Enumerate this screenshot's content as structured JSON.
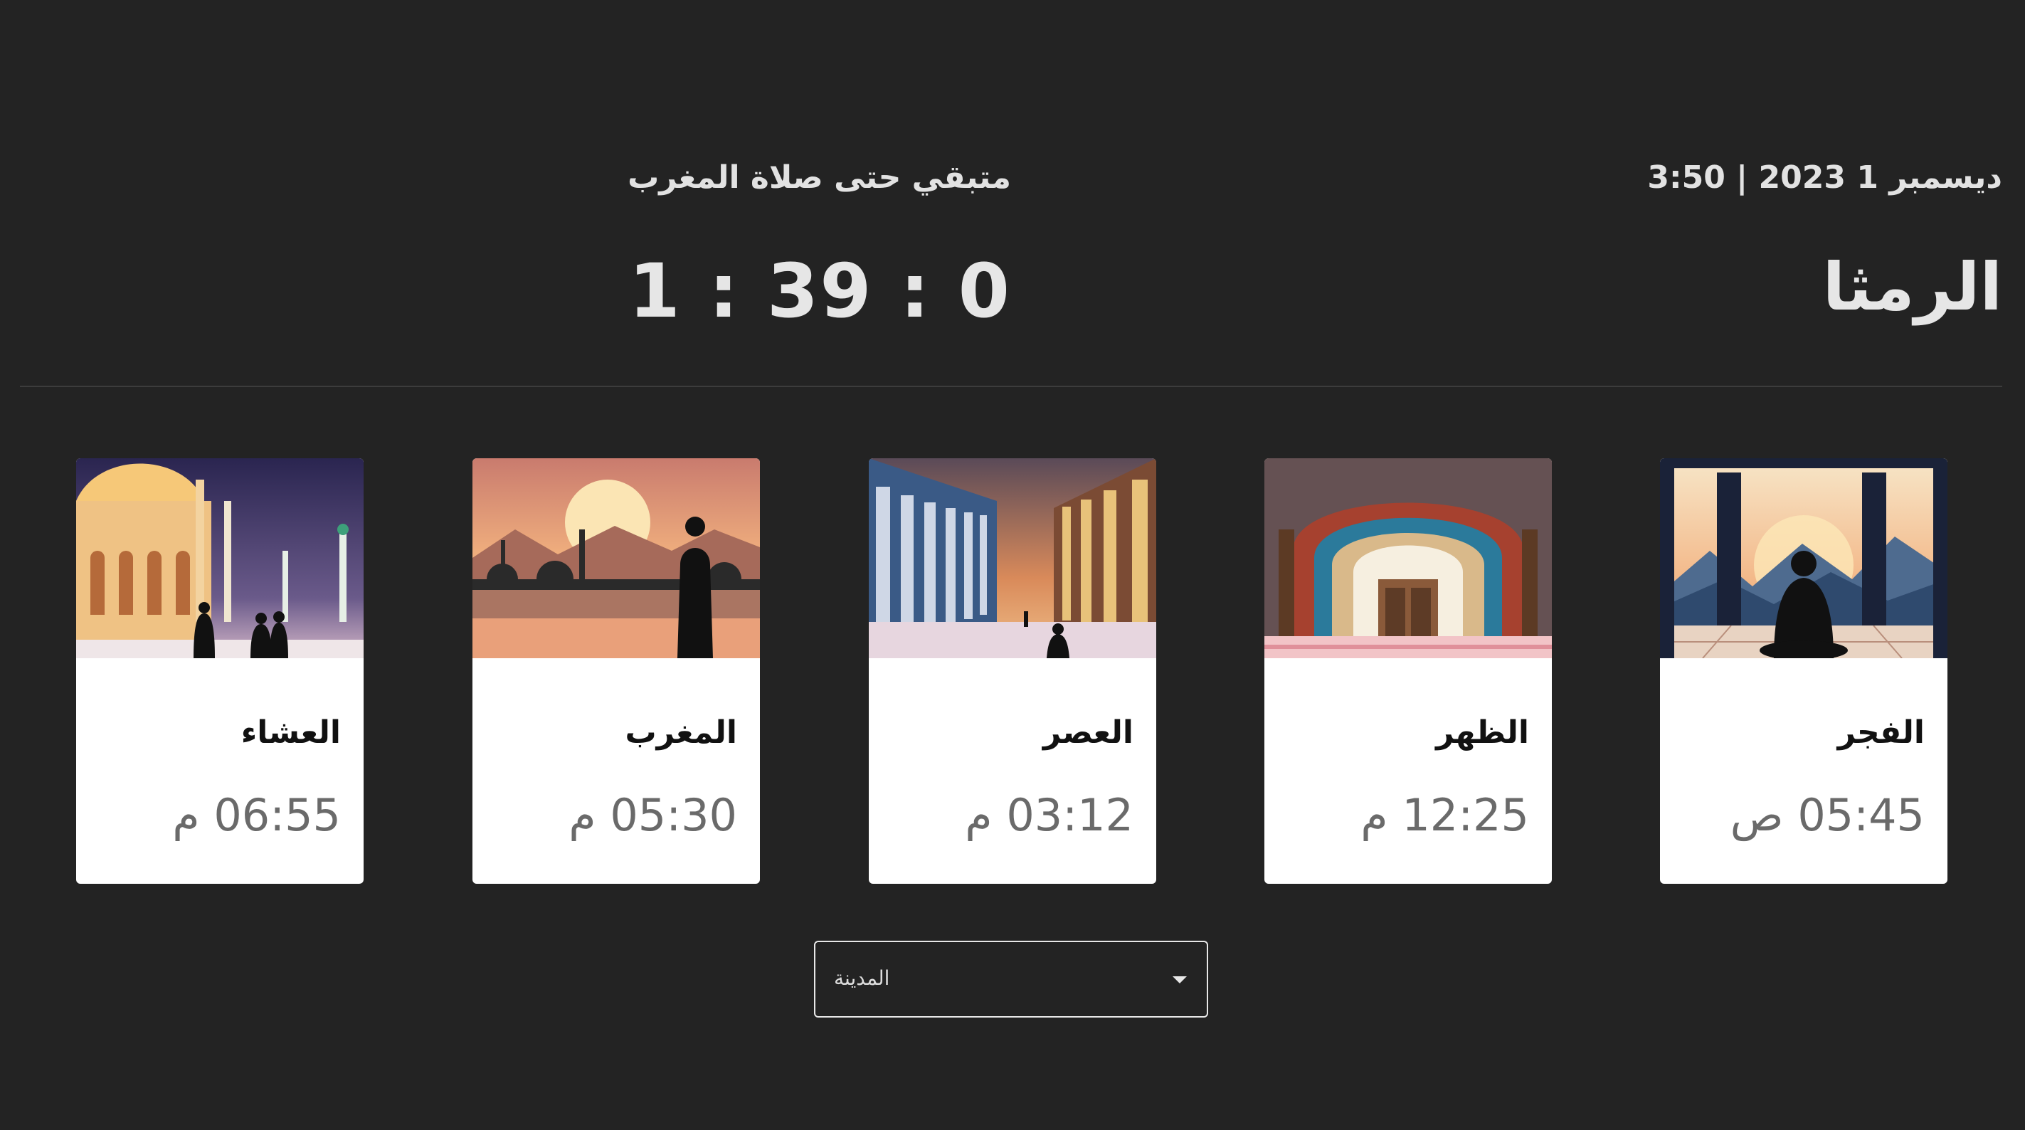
{
  "header": {
    "date_text": "ديسمبر 1 2023 | 3:50",
    "city_title": "الرمثا",
    "remaining_label": "متبقي حتى صلاة المغرب",
    "countdown": "1 : 39 : 0"
  },
  "prayers": [
    {
      "name": "الفجر",
      "time": "05:45 ص",
      "image": "sunrise-prayer-silhouette-image"
    },
    {
      "name": "الظهر",
      "time": "12:25 م",
      "image": "mosque-arch-mosaic-image"
    },
    {
      "name": "العصر",
      "time": "03:12 م",
      "image": "mosque-colonnade-image"
    },
    {
      "name": "المغرب",
      "time": "05:30 م",
      "image": "sunset-skyline-silhouette-image"
    },
    {
      "name": "العشاء",
      "time": "06:55 م",
      "image": "night-mosque-image"
    }
  ],
  "city_select": {
    "placeholder": "المدينة",
    "icon": "caret-down-icon"
  },
  "colors": {
    "background": "#232323",
    "card": "#ffffff",
    "text_light": "#e6e6e6",
    "time_gray": "#6a6a6a"
  }
}
